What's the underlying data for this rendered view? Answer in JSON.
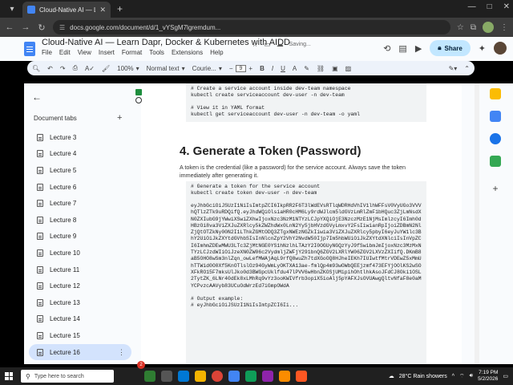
{
  "browser": {
    "tab_title": "Cloud-Native AI — Learn Dapr",
    "url": "docs.google.com/document/d/1_vYSgM7lgremdum..."
  },
  "docs": {
    "title": "Cloud-Native AI — Learn Dapr, Docker & Kubernetes with AIDD",
    "menu": [
      "File",
      "Edit",
      "View",
      "Insert",
      "Format",
      "Tools",
      "Extensions",
      "Help"
    ],
    "saving": "Saving...",
    "share_label": "Share"
  },
  "toolbar": {
    "zoom": "100%",
    "style": "Normal text",
    "font": "Courie...",
    "font_size": "9"
  },
  "left_panel": {
    "title": "Document tabs",
    "tabs": [
      "Lecture 3",
      "Lecture 4",
      "Lecture 5",
      "Lecture 6",
      "Lecture 7",
      "Lecture 8",
      "Lecture 9",
      "Lecture 10",
      "Lecture 11",
      "Lecture 12",
      "Lecture 13",
      "Lecture 14",
      "Lecture 15",
      "Lecture 16"
    ],
    "active_tab": "Lecture 16"
  },
  "document": {
    "code1": [
      "# Create a service account inside dev-team namespace",
      "kubectl create serviceaccount dev-user -n dev-team",
      "",
      "# View it in YAML format",
      "kubectl get serviceaccount dev-user -n dev-team -o yaml"
    ],
    "heading": "4. Generate a Token (Password)",
    "paragraph": "A token is the credential (like a password) for the service account. Always save the token immediately after generating it.",
    "code2_lines": [
      "# Generate a token for the service account",
      "kubectl create token dev-user -n dev-team"
    ],
    "token": "eyJhbGciOiJSUzI1NiIsImtpZCI6IkpRR2F6T3lWdEVsRTlqWDRHdVhIV1lhWFFsV0VyUGo3VVVhQTlzZTk9uRDQifQ.eyJhdWQiOlsiaHR0cHM6Ly9rdWJlcm5ldGVzLmRlZmF1bHQuc3ZjLmNsdXN0ZXIubG9jYWwiXSwiZXhwIjoxNzc3NzM1NTYzLCJpYXQiOjE3NzczMzE1NjMsImlzcyI6Imh0dHBzOi8va3ViZXJuZXRlcy5kZWZhdWx0LnN2Yy5jbHVzdGVyLmxvY2FsIiwianRpIjoiZDBmN2NlZjQtOTZkNy00N2I1LThkZGMtODQ3ZTgxNWEzNGZkIiwia3ViZXJuZXRlcy5pbyI6eyJuYW1lc3BhY2UiOiJkZXYtdGVhbSIsInNlcnZpY2VhY2NvdW50Ijp7Im5hbWUiOiJkZXYtdXNlciIsInVpZCI6ImhmZDEwMWU3LTc3ZjMtNGE0YS1hNzlhLTAzY2I0OGUyNGQzYyJ9fSwibmJmIjoxNzc3MzMxNTYzLCJzdWIiOiJzeXN0ZW06c2VydmljZWFjY291bnQ6ZGV2LXRlYW06ZGV2LXVzZXIifQ.DKmB8aB5OHO8wSm3nlZqn_owLefMWAjAqL9rfQ8wuZh7tdXGoOQ8HJheIEKh7IUIwtfMtrVDEwZ5xMmUhTTWid0O0Xf5KnOTlslOz94GyWmLyOKTXA13ae-fmlQp4m93wOWbQEEjzmf473EFYjOOlKS2wSOXFkRO15F7mksUlJko0d3BWGpcUklfdu47lPVV6wHbnZKOSjUMipihOhtlhkAsoJFdCJ8Oki1OSL2TytZK_6LNr40dEk8xLMhRq9vYz3ooKWIVfrb3opiX5ioAlj5pYAFXJsOVUAwgQltvNfaF8e0aMYCPvzcAAVyb83UCuOdWrzEd7iGmpOWdA",
    "output_lines": [
      "# Output example:",
      "# eyJhbGciOiJSUzI1NiIsImtpZCI6Ii..."
    ]
  },
  "taskbar": {
    "search_placeholder": "Type here to search",
    "weather": "28°C  Rain showers",
    "time": "7:19 PM",
    "date": "5/2/2026",
    "badge": "2"
  },
  "colors": {
    "accent": "#c2e7ff",
    "active_tab_bg": "#d3e3fd",
    "docs_blue": "#4285f4"
  }
}
